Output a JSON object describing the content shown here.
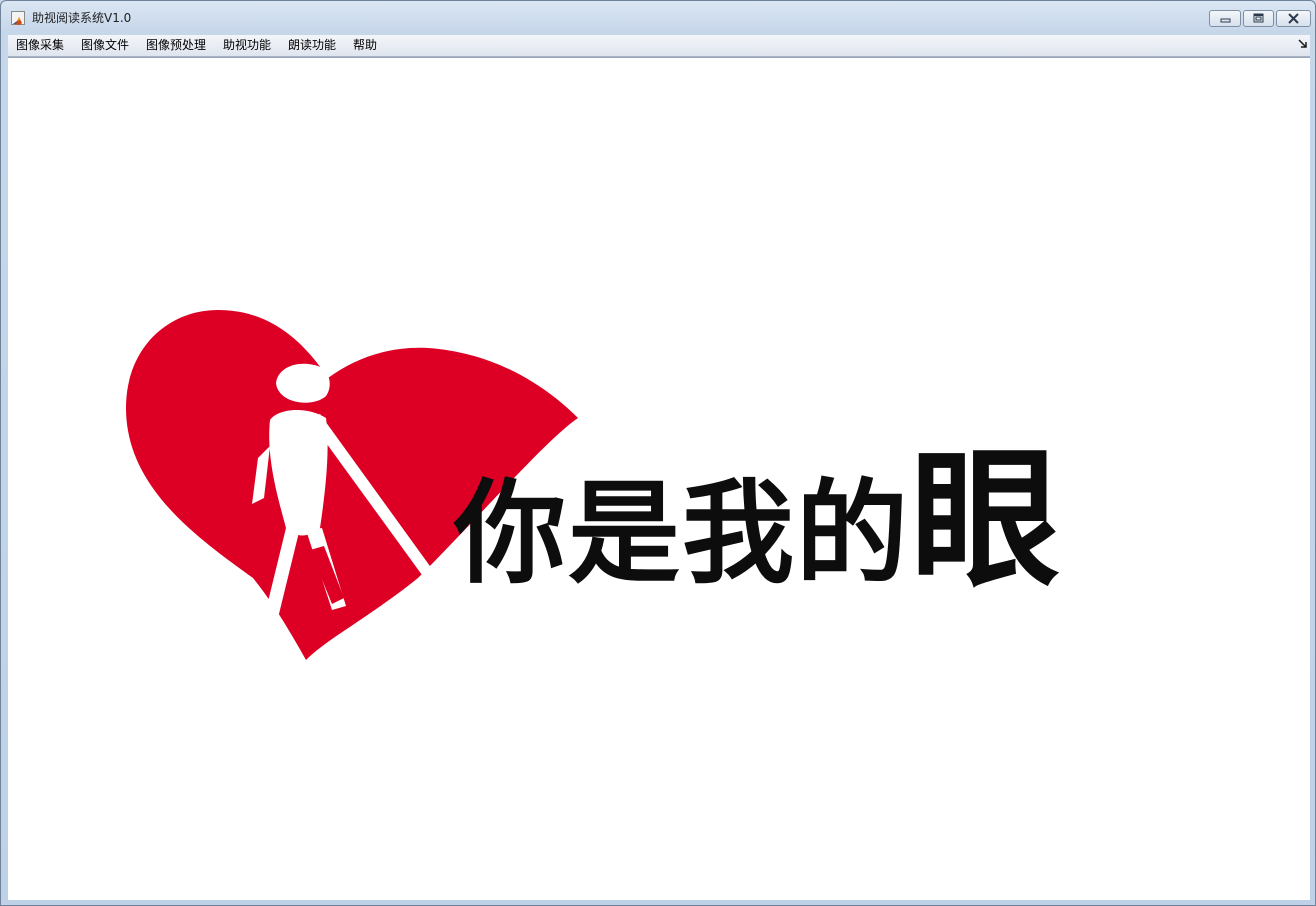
{
  "window": {
    "title": "助视阅读系统V1.0"
  },
  "menu": [
    {
      "label": "图像采集"
    },
    {
      "label": "图像文件"
    },
    {
      "label": "图像预处理"
    },
    {
      "label": "助视功能"
    },
    {
      "label": "朗读功能"
    },
    {
      "label": "帮助"
    }
  ],
  "content": {
    "slogan_main": "你是我的",
    "slogan_emphasis": "眼"
  },
  "colors": {
    "heart_red": "#de0024",
    "text_black": "#0d0d0d",
    "menu_bg": "#e9edf4",
    "frame_blue": "#c7d7ea"
  },
  "icons": {
    "app": "matlab-logo-icon",
    "minimize": "minimize-icon",
    "maximize": "restore-icon",
    "close": "close-icon",
    "toolbar_toggle": "toolbar-toggle-icon",
    "logo_figure": "blind-person-with-cane-icon"
  }
}
